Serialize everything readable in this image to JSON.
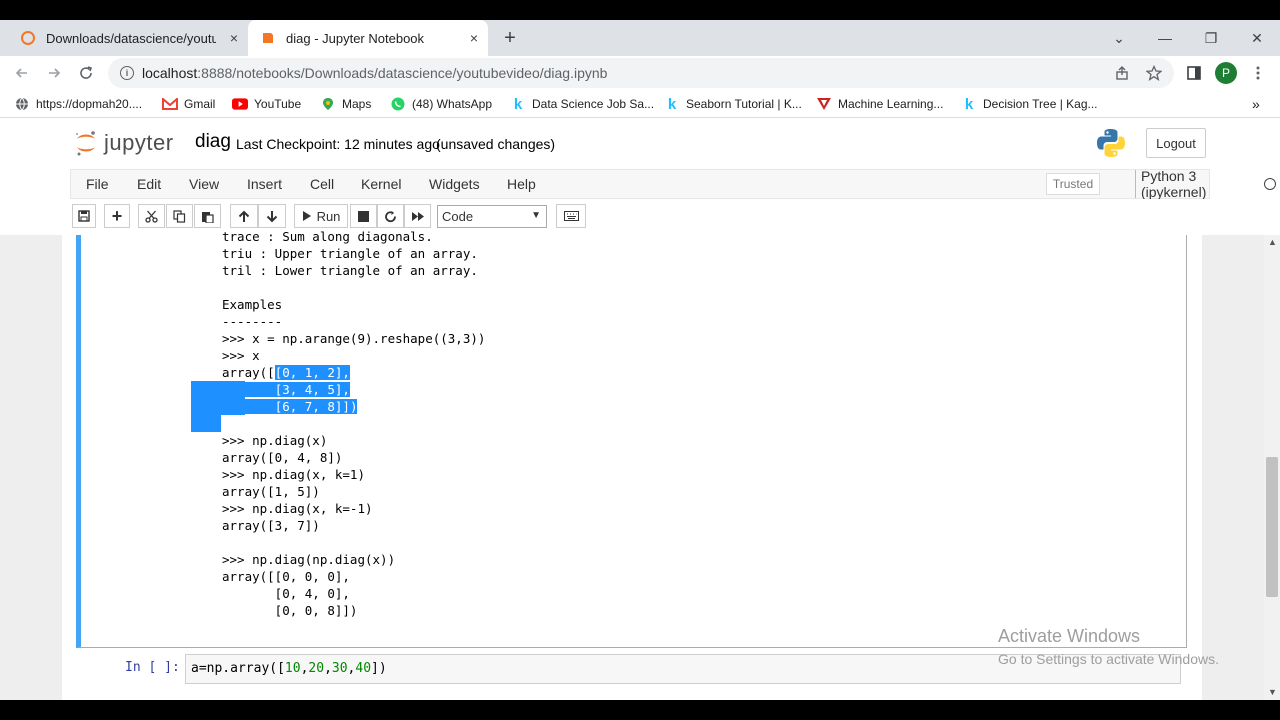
{
  "browser": {
    "tabs": [
      {
        "title": "Downloads/datascience/youtube",
        "close": "×"
      },
      {
        "title": "diag - Jupyter Notebook",
        "close": "×"
      }
    ],
    "new_tab": "+",
    "window_controls": {
      "dropdown": "⌄",
      "minimize": "—",
      "restore": "❐",
      "close": "✕"
    },
    "address": {
      "host": "localhost",
      "path": ":8888/notebooks/Downloads/datascience/youtubevideo/diag.ipynb"
    },
    "profile_initial": "P",
    "bookmarks": [
      {
        "label": "https://dopmah20....",
        "icon": "globe-icon"
      },
      {
        "label": "Gmail",
        "icon": "gmail-icon"
      },
      {
        "label": "YouTube",
        "icon": "youtube-icon"
      },
      {
        "label": "Maps",
        "icon": "maps-icon"
      },
      {
        "label": "(48) WhatsApp",
        "icon": "whatsapp-icon"
      },
      {
        "label": "Data Science Job Sa...",
        "icon": "kaggle-icon"
      },
      {
        "label": "Seaborn Tutorial | K...",
        "icon": "kaggle-icon"
      },
      {
        "label": "Machine Learning...",
        "icon": "ml-icon"
      },
      {
        "label": "Decision Tree | Kag...",
        "icon": "kaggle-icon"
      }
    ],
    "bookmarks_more": "»"
  },
  "jupyter": {
    "logo_text": "jupyter",
    "notebook_name": "diag",
    "checkpoint": "Last Checkpoint: 12 minutes ago",
    "unsaved": "(unsaved changes)",
    "logout": "Logout",
    "menu": [
      "File",
      "Edit",
      "View",
      "Insert",
      "Cell",
      "Kernel",
      "Widgets",
      "Help"
    ],
    "trusted": "Trusted",
    "kernel": "Python 3 (ipykernel)",
    "toolbar": {
      "run": "Run",
      "cell_type": "Code"
    }
  },
  "output": {
    "lines": [
      "trace : Sum along diagonals.",
      "triu : Upper triangle of an array.",
      "tril : Lower triangle of an array.",
      "",
      "Examples",
      "--------",
      ">>> x = np.arange(9).reshape((3,3))",
      ">>> x",
      "array([[0, 1, 2],",
      "       [3, 4, 5],",
      "       [6, 7, 8]])",
      "",
      ">>> np.diag(x)",
      "array([0, 4, 8])",
      ">>> np.diag(x, k=1)",
      "array([1, 5])",
      ">>> np.diag(x, k=-1)",
      "array([3, 7])",
      "",
      ">>> np.diag(np.diag(x))",
      "array([[0, 0, 0],",
      "       [0, 4, 0],",
      "       [0, 0, 8]])"
    ],
    "selected_1": "[0, 1, 2],",
    "selected_2": "[3, 4, 5],",
    "selected_3": "[6, 7, 8]])",
    "prefix_1": "array([",
    "prefix_2": "       "
  },
  "input_cell": {
    "prompt": "In [ ]:",
    "code_a": "a=np.array([",
    "n1": "10",
    "n2": "20",
    "n3": "30",
    "n4": "40",
    "code_end": "])"
  },
  "watermark": {
    "title": "Activate Windows",
    "subtitle": "Go to Settings to activate Windows."
  }
}
